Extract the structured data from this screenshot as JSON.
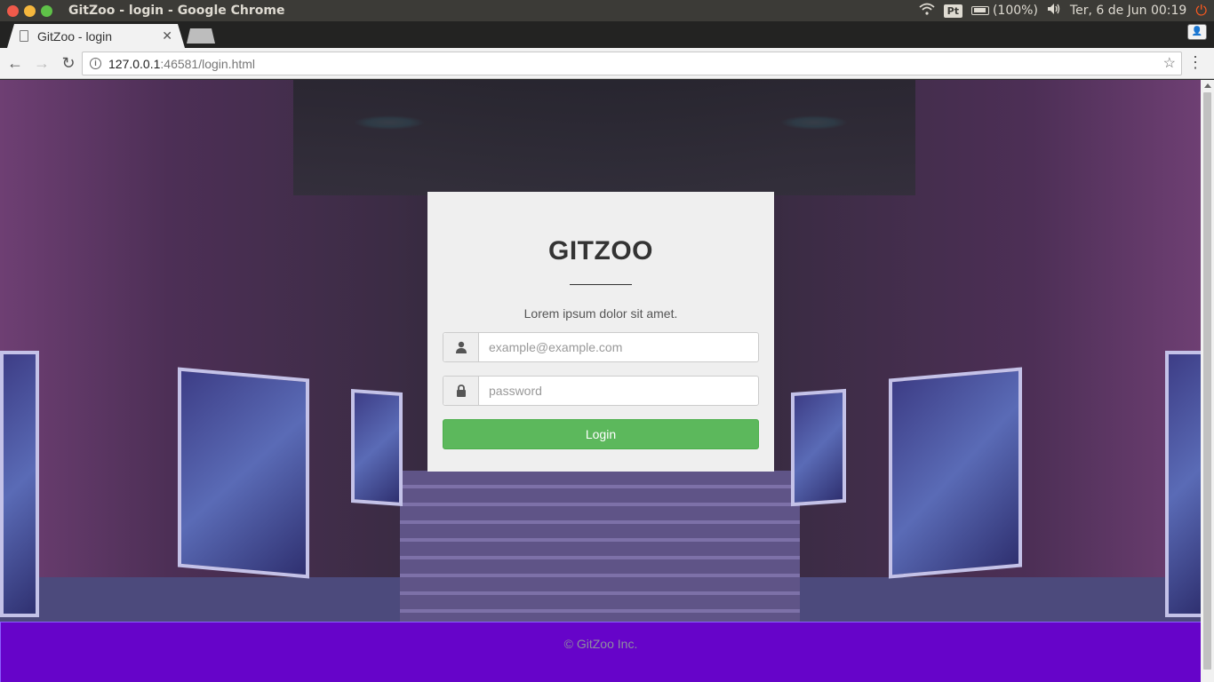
{
  "os": {
    "window_title": "GitZoo - login - Google Chrome",
    "language": "Pt",
    "battery": "(100%)",
    "clock": "Ter,  6 de Jun 00:19"
  },
  "browser": {
    "tab_title": "GitZoo - login",
    "url_host": "127.0.0.1",
    "url_rest": ":46581/login.html"
  },
  "login": {
    "title": "GITZOO",
    "subtitle": "Lorem ipsum dolor sit amet.",
    "email_placeholder": "example@example.com",
    "password_placeholder": "password",
    "button_label": "Login"
  },
  "footer": {
    "text": "© GitZoo Inc."
  },
  "colors": {
    "footer_bg": "#6604c9",
    "login_button": "#5cb85c",
    "card_bg": "#efefef"
  }
}
